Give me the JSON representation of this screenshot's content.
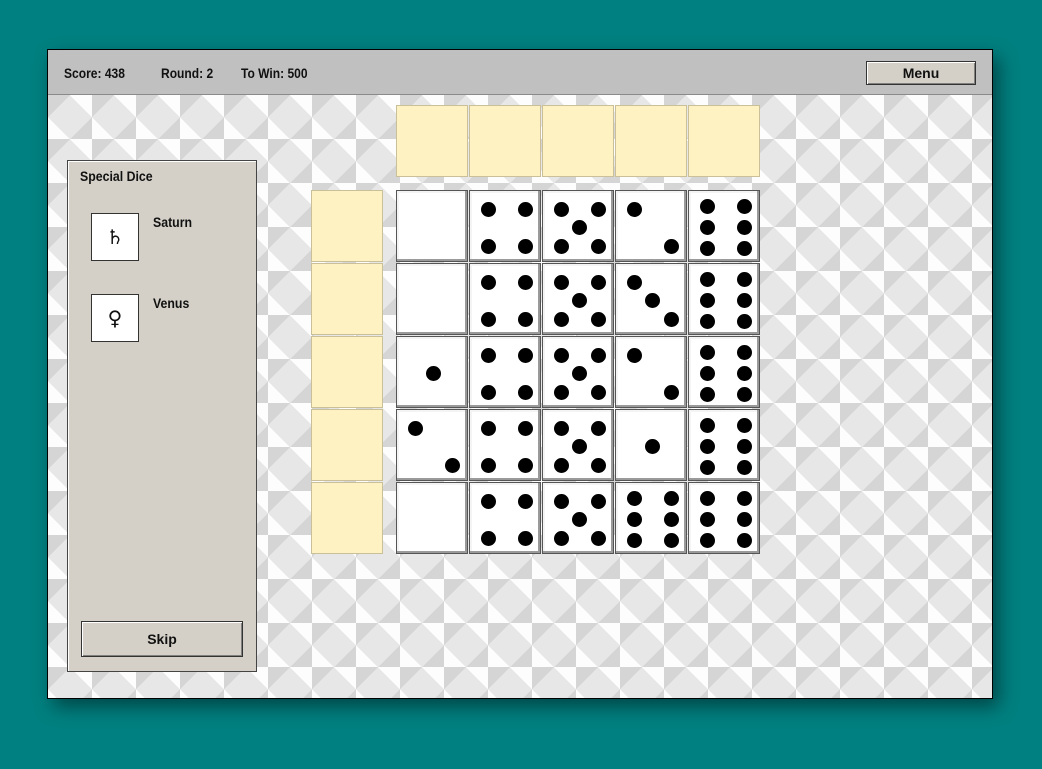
{
  "status": {
    "score": "Score: 438",
    "round": "Round: 2",
    "to_win": "To Win: 500"
  },
  "menu_label": "Menu",
  "special_panel": {
    "title": "Special Dice",
    "dice": [
      {
        "symbol": "♄",
        "name": "Saturn",
        "icon": "saturn-icon"
      },
      {
        "symbol": "♀",
        "name": "Venus",
        "icon": "venus-icon"
      }
    ],
    "skip_label": "Skip"
  },
  "board": {
    "columns": 5,
    "rows": 5,
    "grid": [
      [
        0,
        4,
        5,
        2,
        6
      ],
      [
        0,
        4,
        5,
        3,
        6
      ],
      [
        1,
        4,
        5,
        2,
        6
      ],
      [
        2,
        4,
        5,
        1,
        6
      ],
      [
        0,
        4,
        5,
        6,
        6
      ]
    ],
    "top_slots": [
      "",
      "",
      "",
      "",
      ""
    ],
    "side_slots": [
      "",
      "",
      "",
      "",
      ""
    ]
  },
  "colors": {
    "background": "#008080",
    "slot": "#fff2c2",
    "panel": "#d4d0c8"
  }
}
